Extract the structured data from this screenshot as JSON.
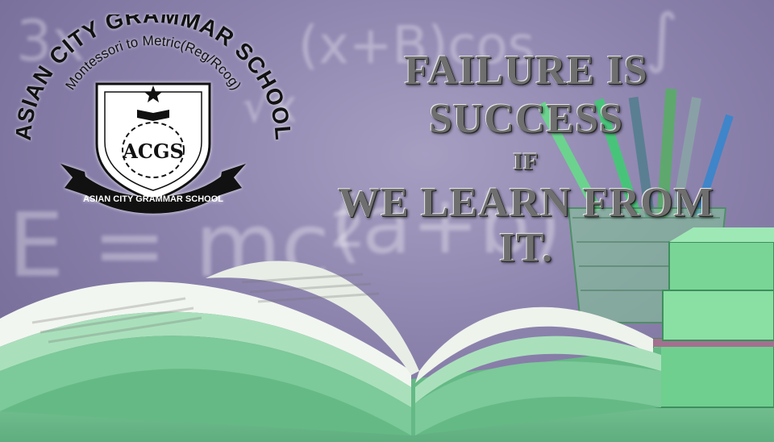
{
  "logo": {
    "school_name": "ASIAN CITY GRAMMAR SCHOOL",
    "tagline": "Montessori to Metric(Reg/Rcog)",
    "monogram": "ACGS",
    "ribbon_text": "ASIAN CITY GRAMMAR SCHOOL"
  },
  "quote": {
    "line1": "FAILURE IS SUCCESS",
    "line2": "IF",
    "line3": "WE LEARN FROM IT."
  },
  "background": {
    "chalk": [
      "(x+B)cos",
      "E = mc²",
      "(a+b)",
      "√x",
      "∫",
      "3x"
    ]
  }
}
